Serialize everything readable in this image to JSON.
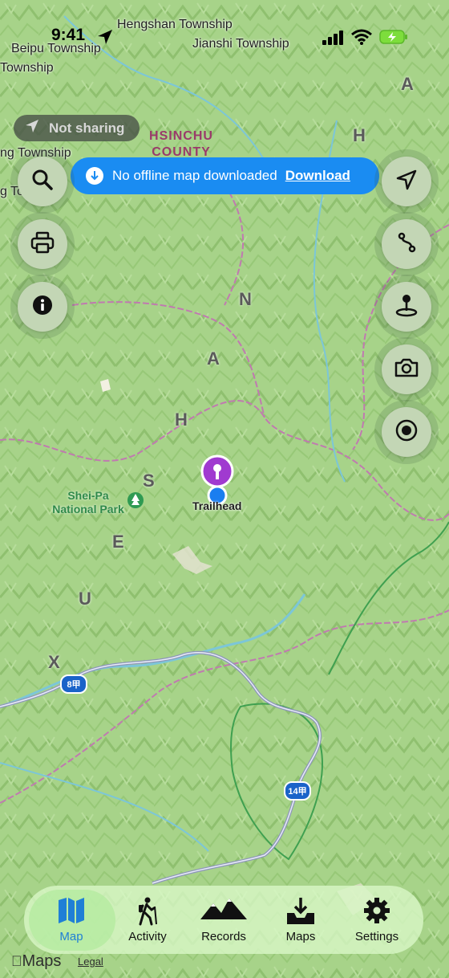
{
  "status": {
    "time": "9:41"
  },
  "map": {
    "places": {
      "hengshan": "Hengshan Township",
      "jianshi": "Jianshi Township",
      "beipu": "Beipu Township",
      "township_left": "Township",
      "ng_township": "ng Township",
      "g_township": "g Township",
      "county": "HSINCHU COUNTY",
      "poi": "Shei-Pa National Park",
      "trailhead": "Trailhead",
      "route8": "8甲",
      "route14": "14甲"
    },
    "range_letters": [
      "X",
      "U",
      "E",
      "S",
      "H",
      "A",
      "N"
    ],
    "right_letters": [
      "A",
      "H"
    ],
    "trailhead_pin_color": "#a03ad0",
    "location_dot_color": "#1a7ef0"
  },
  "sharing": {
    "label": "Not sharing"
  },
  "banner": {
    "message": "No offline map downloaded",
    "action": "Download",
    "color": "#1a8cf2"
  },
  "left_controls": [
    {
      "name": "search-button",
      "icon": "search-icon"
    },
    {
      "name": "print-button",
      "icon": "printer-icon"
    },
    {
      "name": "info-button",
      "icon": "info-icon"
    }
  ],
  "right_controls": [
    {
      "name": "locate-button",
      "icon": "navigation-arrow-icon"
    },
    {
      "name": "route-button",
      "icon": "route-icon"
    },
    {
      "name": "waypoint-button",
      "icon": "pin-icon"
    },
    {
      "name": "camera-button",
      "icon": "camera-icon"
    },
    {
      "name": "record-button",
      "icon": "record-icon"
    }
  ],
  "tabs": [
    {
      "label": "Map",
      "icon": "map-icon",
      "active": true
    },
    {
      "label": "Activity",
      "icon": "hiker-icon",
      "active": false
    },
    {
      "label": "Records",
      "icon": "mountains-icon",
      "active": false
    },
    {
      "label": "Maps",
      "icon": "download-tray-icon",
      "active": false
    },
    {
      "label": "Settings",
      "icon": "gear-icon",
      "active": false
    }
  ],
  "footer": {
    "maps_label": "Maps",
    "legal_label": "Legal"
  }
}
